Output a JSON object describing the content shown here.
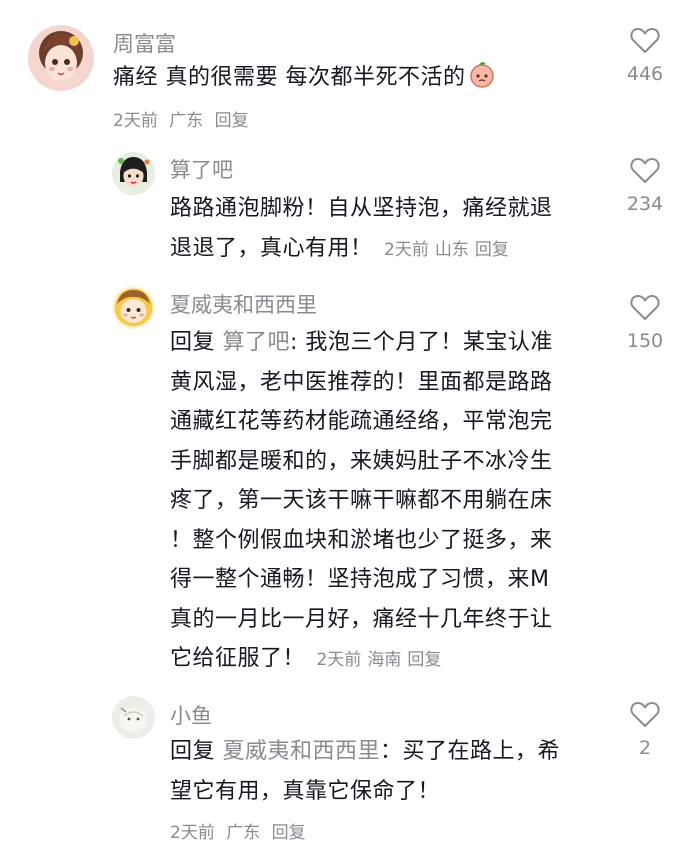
{
  "comments": [
    {
      "username": "周富富",
      "text": "痛经 真的很需要 每次都半死不活的",
      "emoji": "peach-face-emoji",
      "time": "2天前",
      "location": "广东",
      "reply_label": "回复",
      "likes": "446"
    },
    {
      "username": "算了吧",
      "text_line1": "路路通泡脚粉！自从坚持泡，痛经就退",
      "text_line2": "退退了，真心有用！",
      "time": "2天前",
      "location": "山东",
      "reply_label": "回复",
      "likes": "234"
    },
    {
      "username": "夏威夷和西西里",
      "reply_prefix": "回复",
      "mention": "算了吧",
      "lines": [
        ": 我泡三个月了！某宝认准",
        "黄风湿，老中医推荐的！里面都是路路",
        "通藏红花等药材能疏通经络，平常泡完",
        "手脚都是暖和的，来姨妈肚子不冰冷生",
        "疼了，第一天该干嘛干嘛都不用躺在床",
        "！整个例假血块和淤堵也少了挺多，来",
        "得一整个通畅！坚持泡成了习惯，来M",
        "真的一月比一月好，痛经十几年终于让"
      ],
      "last_line": "它给征服了！",
      "time": "2天前",
      "location": "海南",
      "reply_label": "回复",
      "likes": "150"
    },
    {
      "username": "小鱼",
      "reply_prefix": "回复",
      "mention": "夏威夷和西西里",
      "line1_rest": "：买了在路上，希",
      "line2": "望它有用，真靠它保命了！",
      "time": "2天前",
      "location": "广东",
      "reply_label": "回复",
      "likes": "2"
    }
  ],
  "icons": {
    "like": "heart-outline-icon"
  },
  "colors": {
    "text": "#161823",
    "secondary": "#8a8b91",
    "background": "#ffffff"
  }
}
